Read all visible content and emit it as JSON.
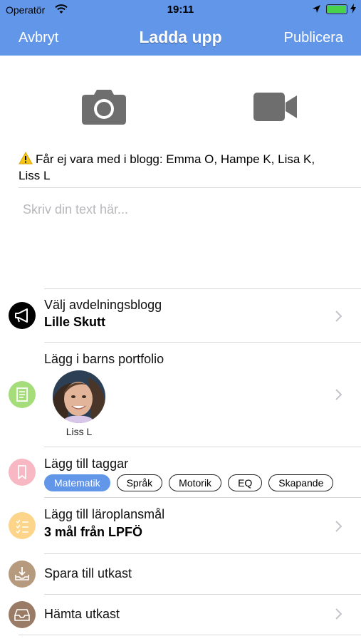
{
  "status_bar": {
    "carrier": "Operatör",
    "time": "19:11"
  },
  "navbar": {
    "cancel_label": "Avbryt",
    "title": "Ladda upp",
    "publish_label": "Publicera"
  },
  "warning": {
    "icon": "warning-icon",
    "text": "Får ej vara med i blogg: Emma O, Hampe K, Lisa K, Liss L"
  },
  "composer": {
    "placeholder": "Skriv din text här...",
    "value": ""
  },
  "rows": {
    "blog": {
      "title": "Välj avdelningsblogg",
      "value": "Lille Skutt",
      "icon": "megaphone-icon",
      "icon_color": "#000000"
    },
    "portfolio": {
      "title": "Lägg i barns portfolio",
      "icon": "document-icon",
      "icon_color": "#a4dd7a",
      "child_name": "Liss L"
    },
    "tags": {
      "title": "Lägg till taggar",
      "icon": "bookmark-icon",
      "icon_color": "#f7b8c4",
      "items": [
        {
          "label": "Matematik",
          "active": true
        },
        {
          "label": "Språk",
          "active": false
        },
        {
          "label": "Motorik",
          "active": false
        },
        {
          "label": "EQ",
          "active": false
        },
        {
          "label": "Skapande",
          "active": false
        }
      ]
    },
    "goals": {
      "title": "Lägg till läroplansmål",
      "value": "3 mål från LPFÖ",
      "icon": "checklist-icon",
      "icon_color": "#fcd48a"
    },
    "save_draft": {
      "title": "Spara till utkast",
      "icon": "download-tray-icon",
      "icon_color": "#b59a7e"
    },
    "get_draft": {
      "title": "Hämta utkast",
      "icon": "inbox-tray-icon",
      "icon_color": "#9a7b66"
    }
  },
  "colors": {
    "accent": "#6296e8",
    "separator": "#d8d8dc",
    "media_icon": "#6e6e6e"
  }
}
